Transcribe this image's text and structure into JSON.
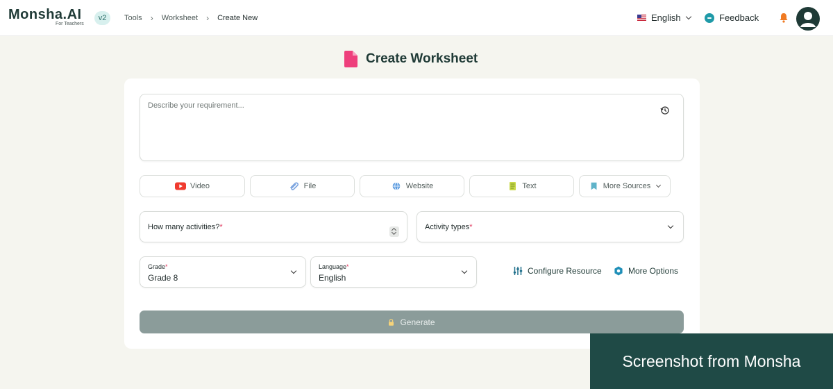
{
  "header": {
    "logo_text": "Monsha.AI",
    "logo_subtitle": "For Teachers",
    "version_badge": "v2",
    "breadcrumb": [
      "Tools",
      "Worksheet",
      "Create New"
    ],
    "language": "English",
    "feedback_label": "Feedback"
  },
  "page": {
    "title": "Create Worksheet"
  },
  "form": {
    "prompt_placeholder": "Describe your requirement...",
    "prompt_value": "",
    "sources": {
      "video": "Video",
      "file": "File",
      "website": "Website",
      "text": "Text",
      "more": "More Sources"
    },
    "activities_label": "How many activities?",
    "activity_types_label": "Activity types",
    "required_mark": "*",
    "grade_label": "Grade",
    "grade_value": "Grade 8",
    "language_label": "Language",
    "language_value": "English",
    "configure_resource": "Configure Resource",
    "more_options": "More Options",
    "generate": "Generate"
  },
  "watermark": "Screenshot from Monsha",
  "colors": {
    "brand_dark": "#1f3a36",
    "accent_teal": "#1f9aa8",
    "required_red": "#e0335a",
    "generate_disabled": "#8b9c9a",
    "title_icon_pink": "#ee3f7c",
    "bell_orange": "#f07a22"
  }
}
